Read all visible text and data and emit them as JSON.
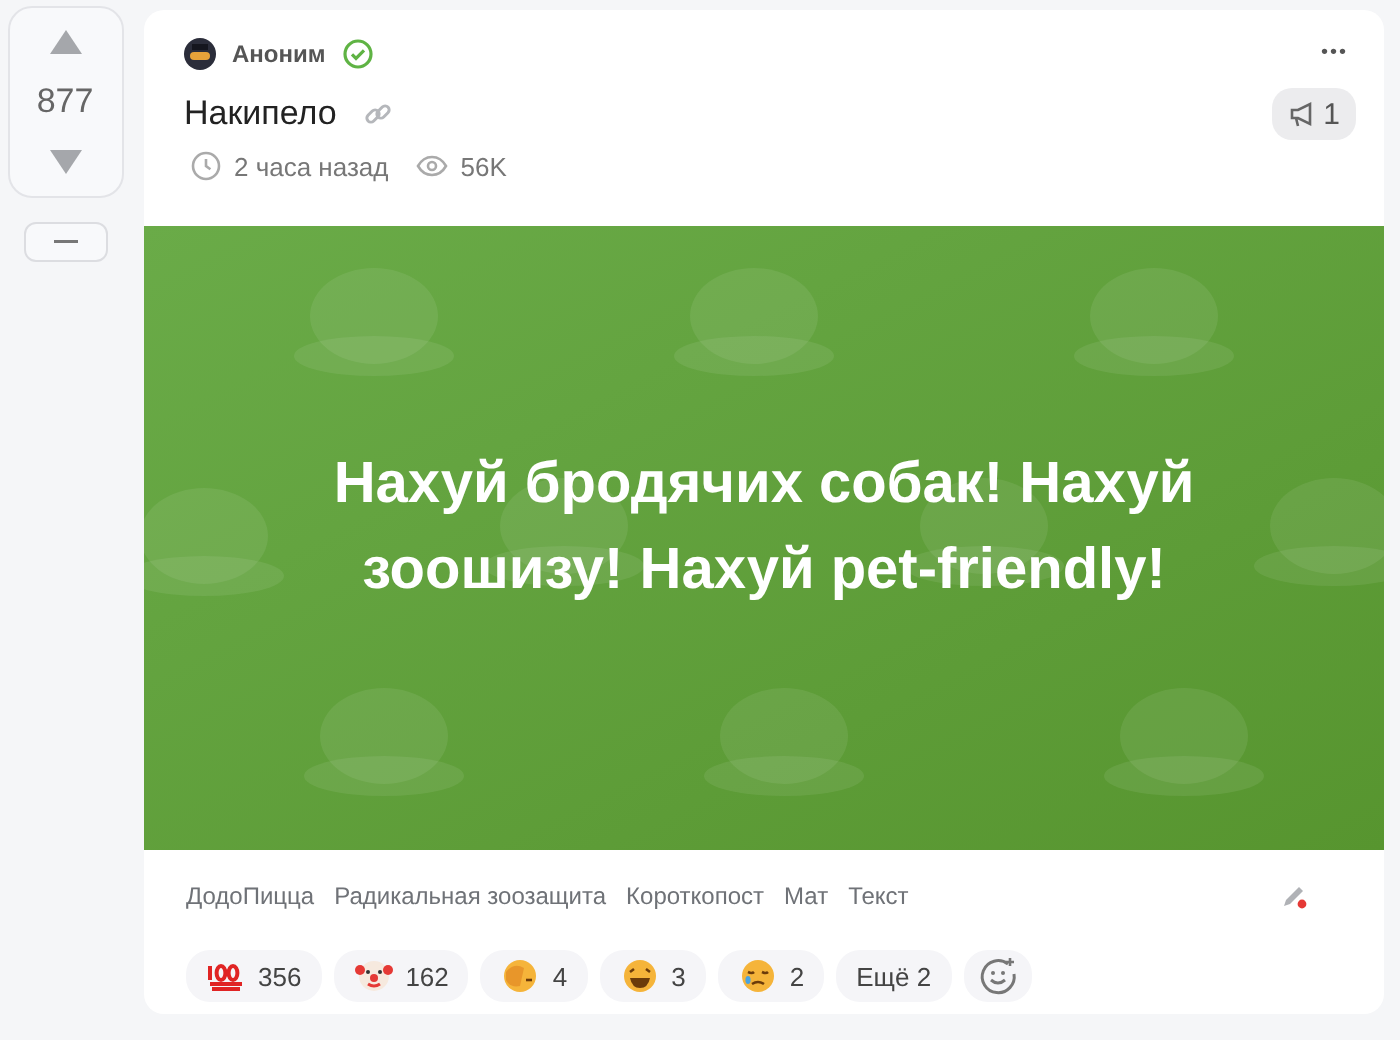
{
  "vote": {
    "score": "877"
  },
  "post": {
    "author": "Аноним",
    "verified": true,
    "title": "Накипело",
    "time": "2 часа назад",
    "views": "56K",
    "menu": "•••",
    "boosts": "1",
    "banner_text": "Нахуй бродячих собак! Нахуй зоошизу! Нахуй pet-friendly!",
    "tags": [
      "ДодоПицца",
      "Радикальная зоозащита",
      "Короткопост",
      "Мат",
      "Текст"
    ],
    "edit_marked": true,
    "reactions": [
      {
        "kind": "hundred",
        "count": "356"
      },
      {
        "kind": "clown",
        "count": "162"
      },
      {
        "kind": "facepalm",
        "count": "4"
      },
      {
        "kind": "laugh",
        "count": "3"
      },
      {
        "kind": "sad",
        "count": "2"
      }
    ],
    "more_reactions": "Ещё 2"
  }
}
